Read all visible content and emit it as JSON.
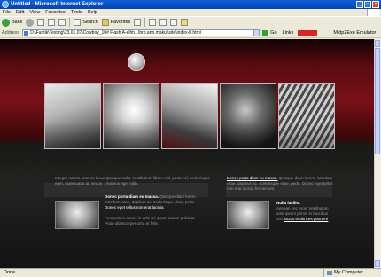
{
  "window": {
    "title": "Untitled - Microsoft Internet Explorer",
    "buttons": [
      "_",
      "□",
      "×"
    ]
  },
  "menu": {
    "items": [
      "File",
      "Edit",
      "View",
      "Favorites",
      "Tools",
      "Help"
    ]
  },
  "toolbar": {
    "back_label": "Back",
    "search_label": "Search",
    "favorites_label": "Favorites"
  },
  "address": {
    "label": "Address",
    "value": "D:\\Funtik\\Testing\\23.01.07\\Cowboy_10# Flash A-elhh...lbro.ann.makul\\site\\index-0.html",
    "go_label": "Go",
    "links_label": "Links",
    "midp_label": "Midp2Exe Emulator"
  },
  "content": {
    "intro_text": "Integer rutrum ante eu lacus Quisque nulla. Vestibulum libero nisl, porta vel, scelerisque eget, malesuada at, neque. Vivamus eget nibh.",
    "left_heading": "Donec porta diam eu massa.",
    "left_text": "Quisque diam lorem, interdum vitae, dapibus ac, scelerisque vitae, pede.",
    "left_link": "Donec eget tellus non erat lacinia.",
    "left_bottom_text": "Fermentum donec in velit vel ipsum auctor pulvinar. Proin ullamcorper urna et felis.",
    "right_heading": "Donec porta diam eu massa.",
    "right_text": "Quisque diam lorem, interdum vitae, dapibus ac, scelerisque vitae, pede. Donec eget tellus non erat lacinia fermentum.",
    "right_sub_heading": "Nulla facilisi.",
    "right_sub_text": "Aenean nec eros. Vestibulum ante ipsum primis in faucibus orci",
    "right_sub_link": "luctus et ultrices posuere"
  },
  "status": {
    "left": "Done",
    "zone": "My Computer"
  },
  "icons": [
    "ie-icon",
    "back-icon",
    "forward-icon",
    "stop-icon",
    "refresh-icon",
    "home-icon",
    "search-icon",
    "favorites-icon",
    "history-icon",
    "mail-icon",
    "print-icon",
    "page-icon",
    "go-icon",
    "globe-logo-icon",
    "computer-icon"
  ]
}
